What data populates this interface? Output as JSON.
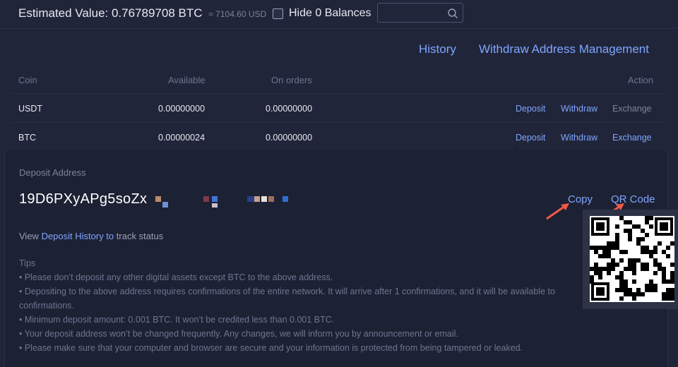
{
  "header": {
    "estimated_label": "Estimated Value: 0.76789708 BTC",
    "estimated_usd": "≈ 7104.60 USD",
    "hide_zero_label": "Hide 0 Balances",
    "search_placeholder": ""
  },
  "links": {
    "history": "History",
    "withdraw_address_management": "Withdraw Address Management"
  },
  "table": {
    "headers": [
      "Coin",
      "Available",
      "On orders",
      "Action"
    ],
    "rows": [
      {
        "coin": "USDT",
        "available": "0.00000000",
        "on_orders": "0.00000000",
        "deposit": "Deposit",
        "withdraw": "Withdraw",
        "exchange": "Exchange"
      },
      {
        "coin": "BTC",
        "available": "0.00000024",
        "on_orders": "0.00000000",
        "deposit": "Deposit",
        "withdraw": "Withdraw",
        "exchange": "Exchange"
      }
    ]
  },
  "deposit_panel": {
    "label": "Deposit Address",
    "address_visible": "19D6PXyAPg5soZx",
    "copy": "Copy",
    "qr_code": "QR Code",
    "view_prefix": "View ",
    "view_link": "Deposit History to",
    "view_suffix": " track status",
    "tips_title": "Tips",
    "tips": [
      "• Please don’t deposit any other digital assets except BTC to the above address.",
      "• Depositing to the above address requires confirmations of the entire network. It will arrive after 1 confirmations, and it will be available to",
      "confirmations.",
      "• Minimum deposit amount: 0.001 BTC. It won’t be credited less than 0.001 BTC.",
      "• Your deposit address won’t be changed frequently. Any changes, we will inform you by announcement or email.",
      "• Please make sure that your computer and browser are secure and your information is protected from being tampered or leaked."
    ]
  },
  "colors": {
    "background": "#212539",
    "panel": "#1d2134",
    "link": "#7ea6ff",
    "annotation_arrow": "#f05a4a"
  },
  "icons": [
    "search-icon",
    "checkbox-icon",
    "qr-code-image",
    "annotation-arrow"
  ]
}
